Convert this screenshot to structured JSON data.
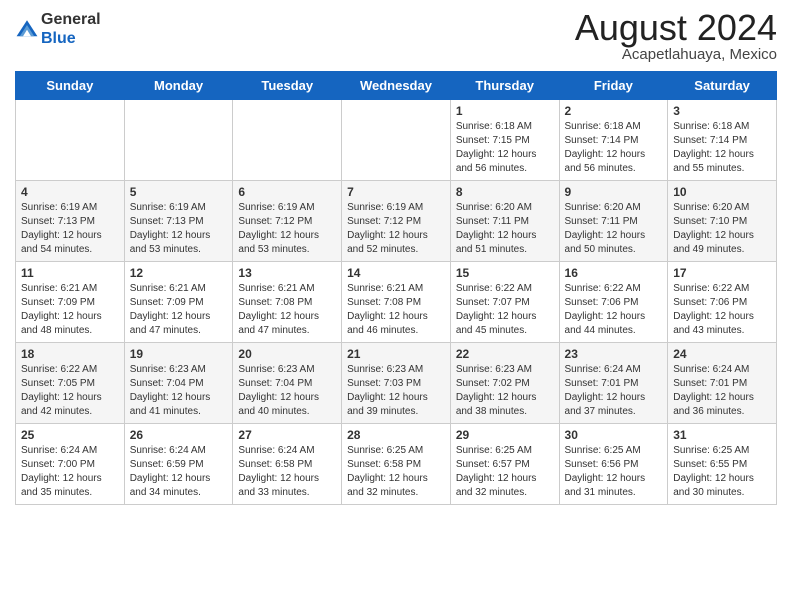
{
  "header": {
    "title": "August 2024",
    "location": "Acapetlahuaya, Mexico",
    "logo_general": "General",
    "logo_blue": "Blue"
  },
  "days_of_week": [
    "Sunday",
    "Monday",
    "Tuesday",
    "Wednesday",
    "Thursday",
    "Friday",
    "Saturday"
  ],
  "weeks": [
    [
      {
        "day": "",
        "sunrise": "",
        "sunset": "",
        "daylight": ""
      },
      {
        "day": "",
        "sunrise": "",
        "sunset": "",
        "daylight": ""
      },
      {
        "day": "",
        "sunrise": "",
        "sunset": "",
        "daylight": ""
      },
      {
        "day": "",
        "sunrise": "",
        "sunset": "",
        "daylight": ""
      },
      {
        "day": "1",
        "sunrise": "Sunrise: 6:18 AM",
        "sunset": "Sunset: 7:15 PM",
        "daylight": "Daylight: 12 hours and 56 minutes."
      },
      {
        "day": "2",
        "sunrise": "Sunrise: 6:18 AM",
        "sunset": "Sunset: 7:14 PM",
        "daylight": "Daylight: 12 hours and 56 minutes."
      },
      {
        "day": "3",
        "sunrise": "Sunrise: 6:18 AM",
        "sunset": "Sunset: 7:14 PM",
        "daylight": "Daylight: 12 hours and 55 minutes."
      }
    ],
    [
      {
        "day": "4",
        "sunrise": "Sunrise: 6:19 AM",
        "sunset": "Sunset: 7:13 PM",
        "daylight": "Daylight: 12 hours and 54 minutes."
      },
      {
        "day": "5",
        "sunrise": "Sunrise: 6:19 AM",
        "sunset": "Sunset: 7:13 PM",
        "daylight": "Daylight: 12 hours and 53 minutes."
      },
      {
        "day": "6",
        "sunrise": "Sunrise: 6:19 AM",
        "sunset": "Sunset: 7:12 PM",
        "daylight": "Daylight: 12 hours and 53 minutes."
      },
      {
        "day": "7",
        "sunrise": "Sunrise: 6:19 AM",
        "sunset": "Sunset: 7:12 PM",
        "daylight": "Daylight: 12 hours and 52 minutes."
      },
      {
        "day": "8",
        "sunrise": "Sunrise: 6:20 AM",
        "sunset": "Sunset: 7:11 PM",
        "daylight": "Daylight: 12 hours and 51 minutes."
      },
      {
        "day": "9",
        "sunrise": "Sunrise: 6:20 AM",
        "sunset": "Sunset: 7:11 PM",
        "daylight": "Daylight: 12 hours and 50 minutes."
      },
      {
        "day": "10",
        "sunrise": "Sunrise: 6:20 AM",
        "sunset": "Sunset: 7:10 PM",
        "daylight": "Daylight: 12 hours and 49 minutes."
      }
    ],
    [
      {
        "day": "11",
        "sunrise": "Sunrise: 6:21 AM",
        "sunset": "Sunset: 7:09 PM",
        "daylight": "Daylight: 12 hours and 48 minutes."
      },
      {
        "day": "12",
        "sunrise": "Sunrise: 6:21 AM",
        "sunset": "Sunset: 7:09 PM",
        "daylight": "Daylight: 12 hours and 47 minutes."
      },
      {
        "day": "13",
        "sunrise": "Sunrise: 6:21 AM",
        "sunset": "Sunset: 7:08 PM",
        "daylight": "Daylight: 12 hours and 47 minutes."
      },
      {
        "day": "14",
        "sunrise": "Sunrise: 6:21 AM",
        "sunset": "Sunset: 7:08 PM",
        "daylight": "Daylight: 12 hours and 46 minutes."
      },
      {
        "day": "15",
        "sunrise": "Sunrise: 6:22 AM",
        "sunset": "Sunset: 7:07 PM",
        "daylight": "Daylight: 12 hours and 45 minutes."
      },
      {
        "day": "16",
        "sunrise": "Sunrise: 6:22 AM",
        "sunset": "Sunset: 7:06 PM",
        "daylight": "Daylight: 12 hours and 44 minutes."
      },
      {
        "day": "17",
        "sunrise": "Sunrise: 6:22 AM",
        "sunset": "Sunset: 7:06 PM",
        "daylight": "Daylight: 12 hours and 43 minutes."
      }
    ],
    [
      {
        "day": "18",
        "sunrise": "Sunrise: 6:22 AM",
        "sunset": "Sunset: 7:05 PM",
        "daylight": "Daylight: 12 hours and 42 minutes."
      },
      {
        "day": "19",
        "sunrise": "Sunrise: 6:23 AM",
        "sunset": "Sunset: 7:04 PM",
        "daylight": "Daylight: 12 hours and 41 minutes."
      },
      {
        "day": "20",
        "sunrise": "Sunrise: 6:23 AM",
        "sunset": "Sunset: 7:04 PM",
        "daylight": "Daylight: 12 hours and 40 minutes."
      },
      {
        "day": "21",
        "sunrise": "Sunrise: 6:23 AM",
        "sunset": "Sunset: 7:03 PM",
        "daylight": "Daylight: 12 hours and 39 minutes."
      },
      {
        "day": "22",
        "sunrise": "Sunrise: 6:23 AM",
        "sunset": "Sunset: 7:02 PM",
        "daylight": "Daylight: 12 hours and 38 minutes."
      },
      {
        "day": "23",
        "sunrise": "Sunrise: 6:24 AM",
        "sunset": "Sunset: 7:01 PM",
        "daylight": "Daylight: 12 hours and 37 minutes."
      },
      {
        "day": "24",
        "sunrise": "Sunrise: 6:24 AM",
        "sunset": "Sunset: 7:01 PM",
        "daylight": "Daylight: 12 hours and 36 minutes."
      }
    ],
    [
      {
        "day": "25",
        "sunrise": "Sunrise: 6:24 AM",
        "sunset": "Sunset: 7:00 PM",
        "daylight": "Daylight: 12 hours and 35 minutes."
      },
      {
        "day": "26",
        "sunrise": "Sunrise: 6:24 AM",
        "sunset": "Sunset: 6:59 PM",
        "daylight": "Daylight: 12 hours and 34 minutes."
      },
      {
        "day": "27",
        "sunrise": "Sunrise: 6:24 AM",
        "sunset": "Sunset: 6:58 PM",
        "daylight": "Daylight: 12 hours and 33 minutes."
      },
      {
        "day": "28",
        "sunrise": "Sunrise: 6:25 AM",
        "sunset": "Sunset: 6:58 PM",
        "daylight": "Daylight: 12 hours and 32 minutes."
      },
      {
        "day": "29",
        "sunrise": "Sunrise: 6:25 AM",
        "sunset": "Sunset: 6:57 PM",
        "daylight": "Daylight: 12 hours and 32 minutes."
      },
      {
        "day": "30",
        "sunrise": "Sunrise: 6:25 AM",
        "sunset": "Sunset: 6:56 PM",
        "daylight": "Daylight: 12 hours and 31 minutes."
      },
      {
        "day": "31",
        "sunrise": "Sunrise: 6:25 AM",
        "sunset": "Sunset: 6:55 PM",
        "daylight": "Daylight: 12 hours and 30 minutes."
      }
    ]
  ]
}
